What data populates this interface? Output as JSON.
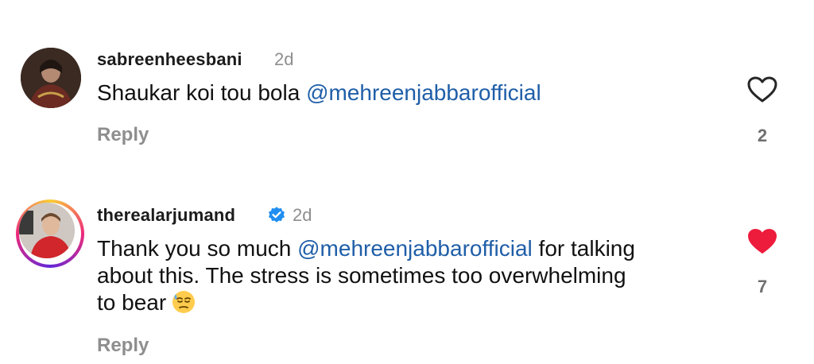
{
  "comments": [
    {
      "username": "sabreenheesbani",
      "time": "2d",
      "text_before": "Shaukar koi tou bola ",
      "mention": "@mehreenjabbarofficial",
      "reply_label": "Reply",
      "like_count": "2",
      "liked": false,
      "verified": false
    },
    {
      "username": "therealarjumand",
      "time": "2d",
      "text_before": "Thank you so much ",
      "mention": "@mehreenjabbarofficial",
      "text_after_mention": " for talking",
      "line2": "about this. The stress is sometimes too overwhelming",
      "line3": "to bear",
      "emoji": "downcast-face-with-sweat",
      "reply_label": "Reply",
      "like_count": "7",
      "liked": true,
      "verified": true
    }
  ],
  "colors": {
    "mention": "#1f5ea8",
    "like_red": "#ed1c3c",
    "verified_blue": "#1f8ef1",
    "muted": "#8e8e8e"
  }
}
